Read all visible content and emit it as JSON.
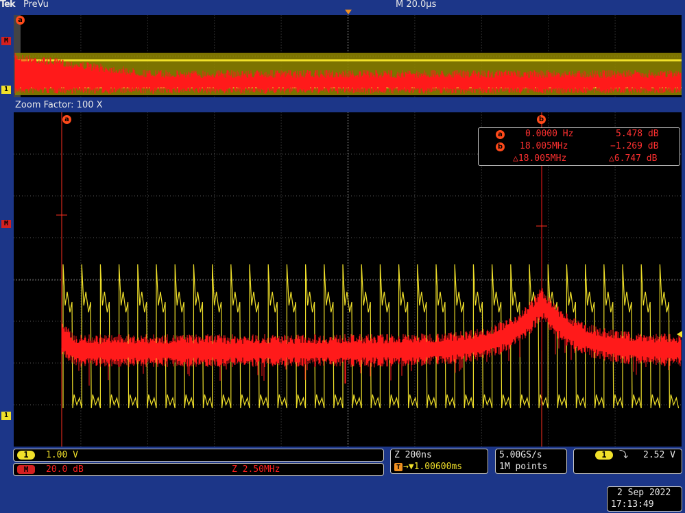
{
  "topbar": {
    "brand": "Tek",
    "mode": "PreVu",
    "timebase": "M 20.0µs"
  },
  "zoom_bar": {
    "label": "Zoom Factor: 100 X"
  },
  "cursors": {
    "a_label": "a",
    "b_label": "b",
    "readout": {
      "a_freq": "0.0000 Hz",
      "a_val": "5.478 dB",
      "b_freq": "18.005MHz",
      "b_val": "−1.269 dB",
      "delta_freq": "△18.005MHz",
      "delta_val": "△6.747 dB"
    }
  },
  "side_markers": {
    "math": "M",
    "ch1": "1"
  },
  "status": {
    "ch1_badge": "1",
    "ch1_scale": "1.00 V",
    "math_badge": "M",
    "math_scale": "20.0 dB",
    "math_zoom": "Z 2.50MHz",
    "zoom_time": "Z 200ns",
    "trigger_pos": "→▼1.00600ms",
    "sample_rate": "5.00GS/s",
    "record_length": "1M points",
    "trig_source": "1",
    "trig_slope": "⤵",
    "trig_level": "2.52 V"
  },
  "datetime": {
    "date": "2 Sep  2022",
    "time": "17:13:49"
  },
  "colors": {
    "ch1": "#f0e02a",
    "math": "#ff1a1a",
    "background": "#1c3688",
    "graticule": "#000000"
  }
}
